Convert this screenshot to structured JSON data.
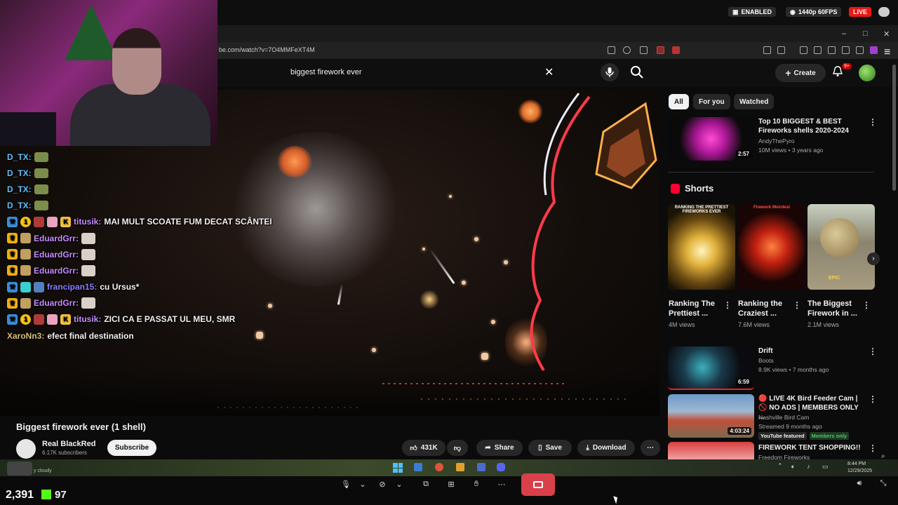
{
  "stream": {
    "enabled_label": "ENABLED",
    "quality_label": "1440p 60FPS",
    "live_label": "LIVE",
    "viewer_count": "2,391",
    "kick_count": "97"
  },
  "browser": {
    "url": "be.com/watch?v=7O4MMFeXT4M"
  },
  "youtube": {
    "search_query": "biggest firework ever",
    "create_label": "Create",
    "notif_badge": "9+",
    "video_title": "Biggest firework ever (1 shell)",
    "channel_name": "Real BlackRed",
    "channel_subs": "6.17K subscribers",
    "subscribe_label": "Subscribe",
    "likes": "431K",
    "share_label": "Share",
    "save_label": "Save",
    "download_label": "Download",
    "chips": [
      "All",
      "For you",
      "Watched"
    ],
    "shorts_label": "Shorts",
    "recommendations": [
      {
        "title": "Top 10 BIGGEST & BEST Fireworks shells 2020-2024",
        "channel": "AndyThePyro",
        "meta": "10M views • 3 years ago",
        "duration": "2:57"
      },
      {
        "title": "Drift",
        "channel": "Boots",
        "meta": "8.9K views • 7 months ago",
        "duration": "6:59"
      },
      {
        "title": "🔴 LIVE 4K Bird Feeder Cam | 🚫 NO ADS | MEMBERS ONLY ...",
        "channel": "Nashville Bird Cam",
        "meta": "Streamed 9 months ago",
        "duration": "4:03:24",
        "tag1": "YouTube featured",
        "tag2": "Members only"
      },
      {
        "title": "FIREWORK TENT SHOPPING!!",
        "channel": "Freedom Fireworks"
      }
    ],
    "shorts": [
      {
        "title": "Ranking The Prettiest ...",
        "views": "4M views",
        "overlay": "RANKING THE PRETTIEST FIREWORKS EVER"
      },
      {
        "title": "Ranking the Craziest ...",
        "views": "7.6M views",
        "overlay": "Firework Weirdest"
      },
      {
        "title": "The Biggest Firework in ...",
        "views": "2.1M views",
        "overlay": "EPIC"
      }
    ]
  },
  "chat": [
    {
      "user": "D_TX:",
      "text": "",
      "color": "#5dc0ff"
    },
    {
      "user": "D_TX:",
      "text": "",
      "color": "#5dc0ff"
    },
    {
      "user": "D_TX:",
      "text": "",
      "color": "#5dc0ff"
    },
    {
      "user": "D_TX:",
      "text": "",
      "color": "#5dc0ff"
    },
    {
      "user": "titusik:",
      "text": "MAI MULT SCOATE FUM DECAT SCÂNTEI",
      "color": "#c58cff"
    },
    {
      "user": "EduardGrr:",
      "text": "",
      "color": "#c58cff"
    },
    {
      "user": "EduardGrr:",
      "text": "",
      "color": "#c58cff"
    },
    {
      "user": "EduardGrr:",
      "text": "",
      "color": "#c58cff"
    },
    {
      "user": "francipan15:",
      "text": "cu Ursus*",
      "color": "#8a7dff"
    },
    {
      "user": "EduardGrr:",
      "text": "",
      "color": "#c58cff"
    },
    {
      "user": "titusik:",
      "text": "ZICI CA E PASSAT UL MEU, SMR",
      "color": "#c58cff"
    },
    {
      "user": "XaroNn3:",
      "text": "efect final destination",
      "color": "#d8c07a"
    }
  ],
  "taskbar": {
    "weather": "y cloudy",
    "time": "8:44 PM",
    "date": "12/29/2025"
  }
}
